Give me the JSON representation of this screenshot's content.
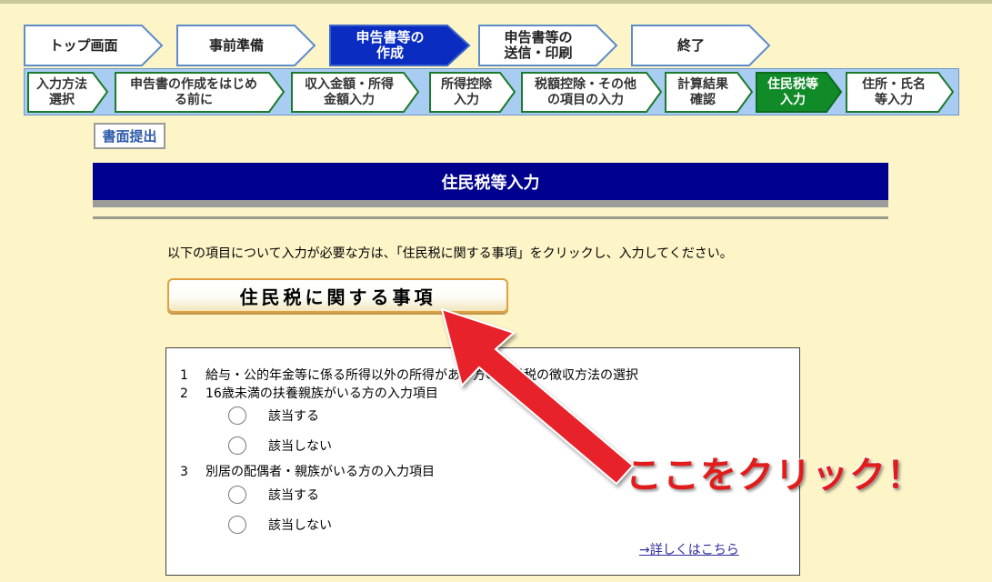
{
  "main_steps": [
    {
      "label": "トップ画面"
    },
    {
      "label": "事前準備"
    },
    {
      "label": "申告書等の\n作成"
    },
    {
      "label": "申告書等の\n送信・印刷"
    },
    {
      "label": "終了"
    }
  ],
  "sub_steps": [
    {
      "label": "入力方法\n選択"
    },
    {
      "label": "申告書の作成をはじめ\nる前に"
    },
    {
      "label": "収入金額・所得\n金額入力"
    },
    {
      "label": "所得控除\n入力"
    },
    {
      "label": "税額控除・その他\nの項目の入力"
    },
    {
      "label": "計算結果\n確認"
    },
    {
      "label": "住民税等\n入力"
    },
    {
      "label": "住所・氏名\n等入力"
    }
  ],
  "paper_submit_label": "書面提出",
  "page_title": "住民税等入力",
  "instruction": "以下の項目について入力が必要な方は、「住民税に関する事項」をクリックし、入力してください。",
  "resident_tax_button": "住民税に関する事項",
  "items": [
    {
      "num": "1",
      "text": "給与・公的年金等に係る所得以外の所得がある方の住民税の徴収方法の選択"
    },
    {
      "num": "2",
      "text": "16歳未満の扶養親族がいる方の入力項目"
    },
    {
      "num": "3",
      "text": "別居の配偶者・親族がいる方の入力項目"
    }
  ],
  "options": {
    "yes": "該当する",
    "no": "該当しない"
  },
  "more_link": "→詳しくはこちら",
  "annotation": "ここをクリック！",
  "colors": {
    "background": "#fdf5c8",
    "title_bar": "#00008f",
    "active_main_step": "#0a2cc0",
    "active_sub_step": "#118a28",
    "sub_bar": "#a8ccf2",
    "annotation_red": "#e21b1b"
  }
}
